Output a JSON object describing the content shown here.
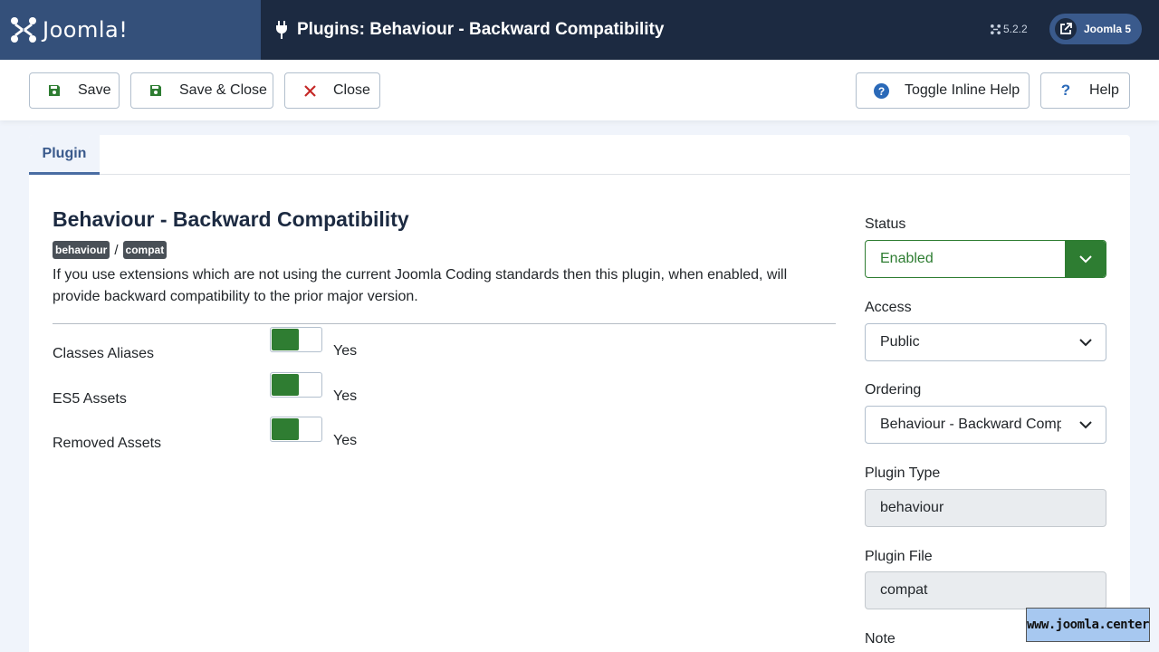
{
  "header": {
    "logo_text": "Joomla!",
    "page_title": "Plugins: Behaviour - Backward Compatibility",
    "version": "5.2.2",
    "site_link_label": "Joomla 5"
  },
  "toolbar": {
    "save_label": "Save",
    "save_close_label": "Save & Close",
    "close_label": "Close",
    "toggle_help_label": "Toggle Inline Help",
    "help_label": "Help"
  },
  "tabs": [
    {
      "label": "Plugin",
      "active": true
    }
  ],
  "plugin": {
    "title": "Behaviour - Backward Compatibility",
    "tags": [
      "behaviour",
      "compat"
    ],
    "tag_separator": "/",
    "description": "If you use extensions which are not using the current Joomla Coding standards then this plugin, when enabled, will provide backward compatibility to the prior major version."
  },
  "options": [
    {
      "label": "Classes Aliases",
      "value": "Yes",
      "enabled": true
    },
    {
      "label": "ES5 Assets",
      "value": "Yes",
      "enabled": true
    },
    {
      "label": "Removed Assets",
      "value": "Yes",
      "enabled": true
    }
  ],
  "sidebar": {
    "status": {
      "label": "Status",
      "value": "Enabled"
    },
    "access": {
      "label": "Access",
      "value": "Public"
    },
    "ordering": {
      "label": "Ordering",
      "value": "Behaviour - Backward Compatibility"
    },
    "plugin_type": {
      "label": "Plugin Type",
      "value": "behaviour"
    },
    "plugin_file": {
      "label": "Plugin File",
      "value": "compat"
    },
    "note": {
      "label": "Note"
    }
  },
  "watermark": "www.joomla.center",
  "colors": {
    "header_bg": "#1c2a41",
    "logo_bg": "#34507a",
    "toggle_on": "#2f7d32",
    "status_green": "#2e7d32",
    "danger_red": "#c52827",
    "help_blue": "#2a69b8"
  }
}
